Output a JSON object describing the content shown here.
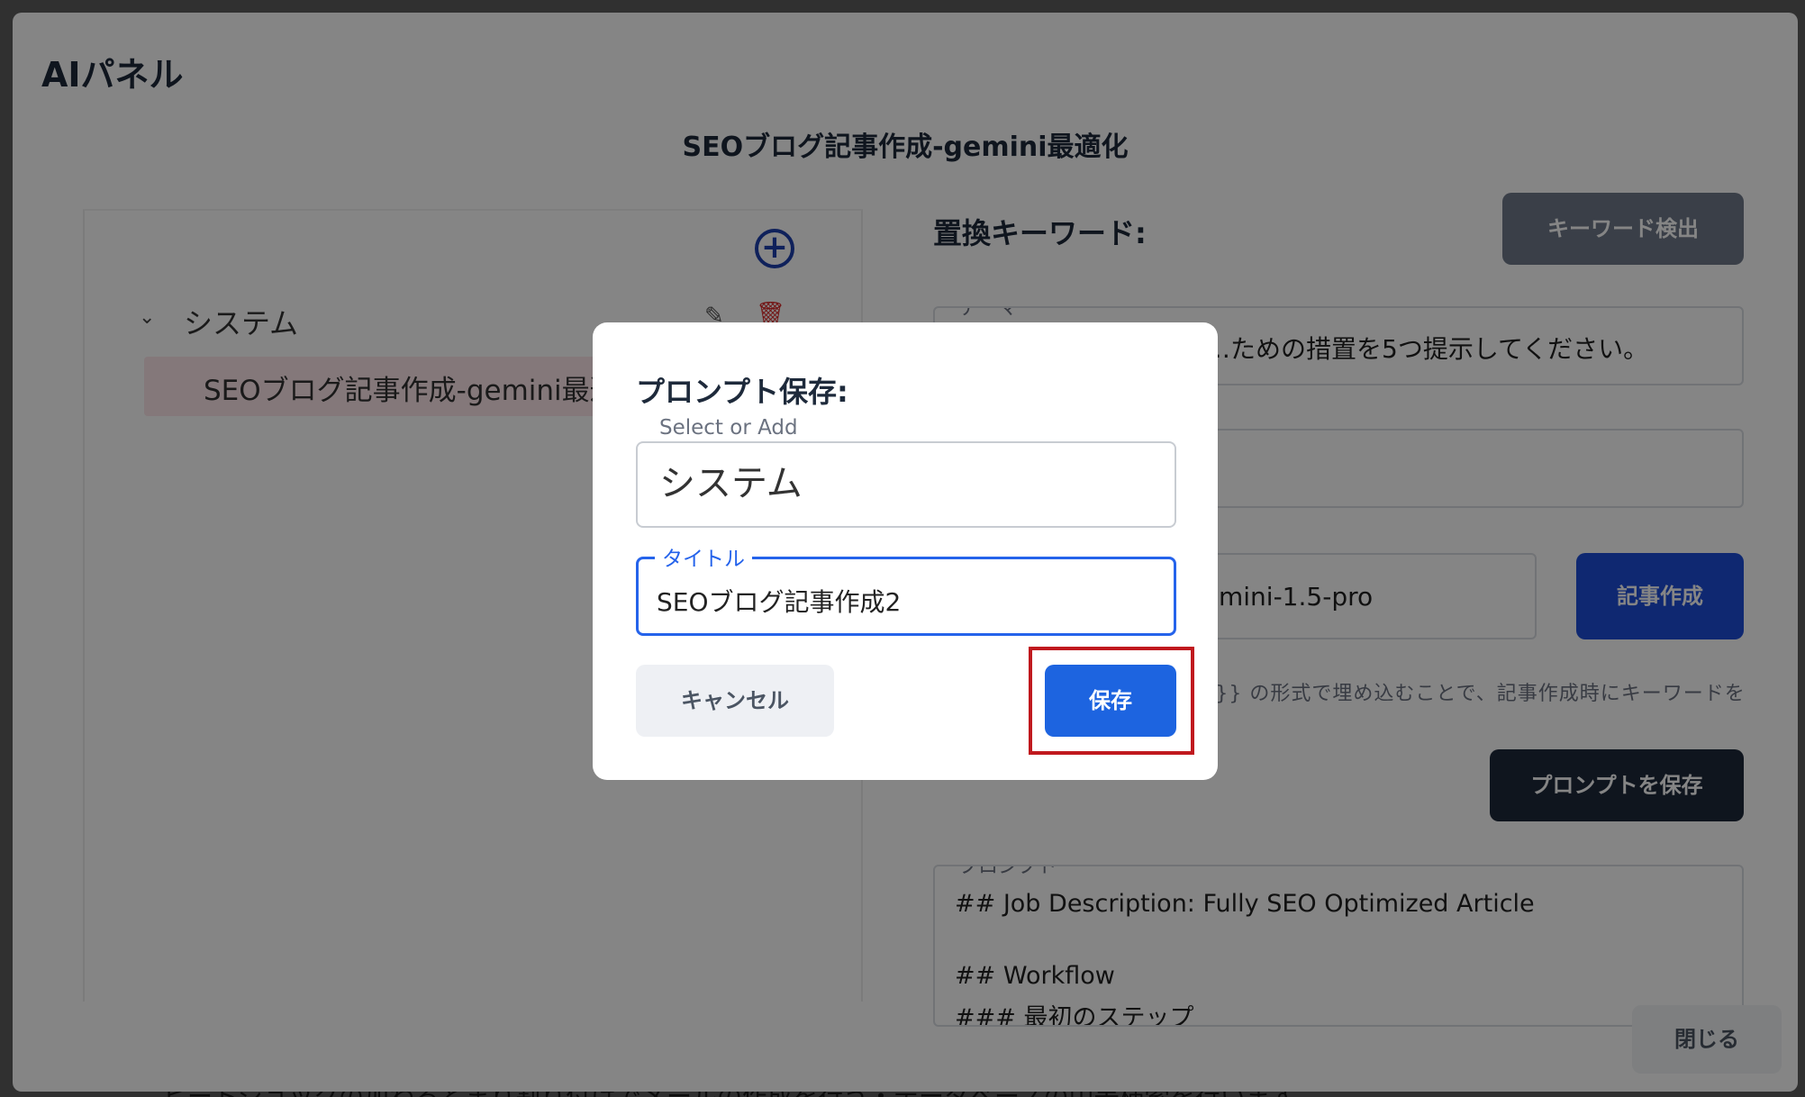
{
  "background": {
    "bottom_text": "ヒートジョックの加わるとまり割り付けでメールの作成を行う・データベースの中等検索を行います"
  },
  "panel": {
    "title": "AIパネル",
    "prompt_name": "SEOブログ記事作成-gemini最適化",
    "tree": {
      "group_label": "システム",
      "item_label": "SEOブログ記事作成-gemini最適化"
    },
    "keywords": {
      "heading": "置換キーワード:",
      "detect_button": "キーワード検出",
      "theme_legend": "テーマ",
      "theme_value": "…ための措置を5つ提示してください。",
      "model_value": "gemini-1.5-pro",
      "create_button": "記事作成",
      "hint": "プロンプト中に {{キーワード}} の形式で埋め込むことで、記事作成時にキーワードを置換で"
    },
    "save_prompt_button": "プロンプトを保存",
    "prompt": {
      "legend": "プロンプト",
      "lines": [
        "## Job Description: Fully SEO Optimized Article",
        "",
        "## Workflow",
        "### 最初のステップ"
      ]
    },
    "close_button": "閉じる"
  },
  "dialog": {
    "title": "プロンプト保存:",
    "select_label": "Select or Add",
    "select_value": "システム",
    "title_label": "タイトル",
    "title_value": "SEOブログ記事作成2",
    "cancel_button": "キャンセル",
    "save_button": "保存"
  },
  "colors": {
    "primary": "#1d64e0",
    "dark": "#1e293b",
    "highlight": "#c0191e",
    "danger": "#dc2626"
  }
}
